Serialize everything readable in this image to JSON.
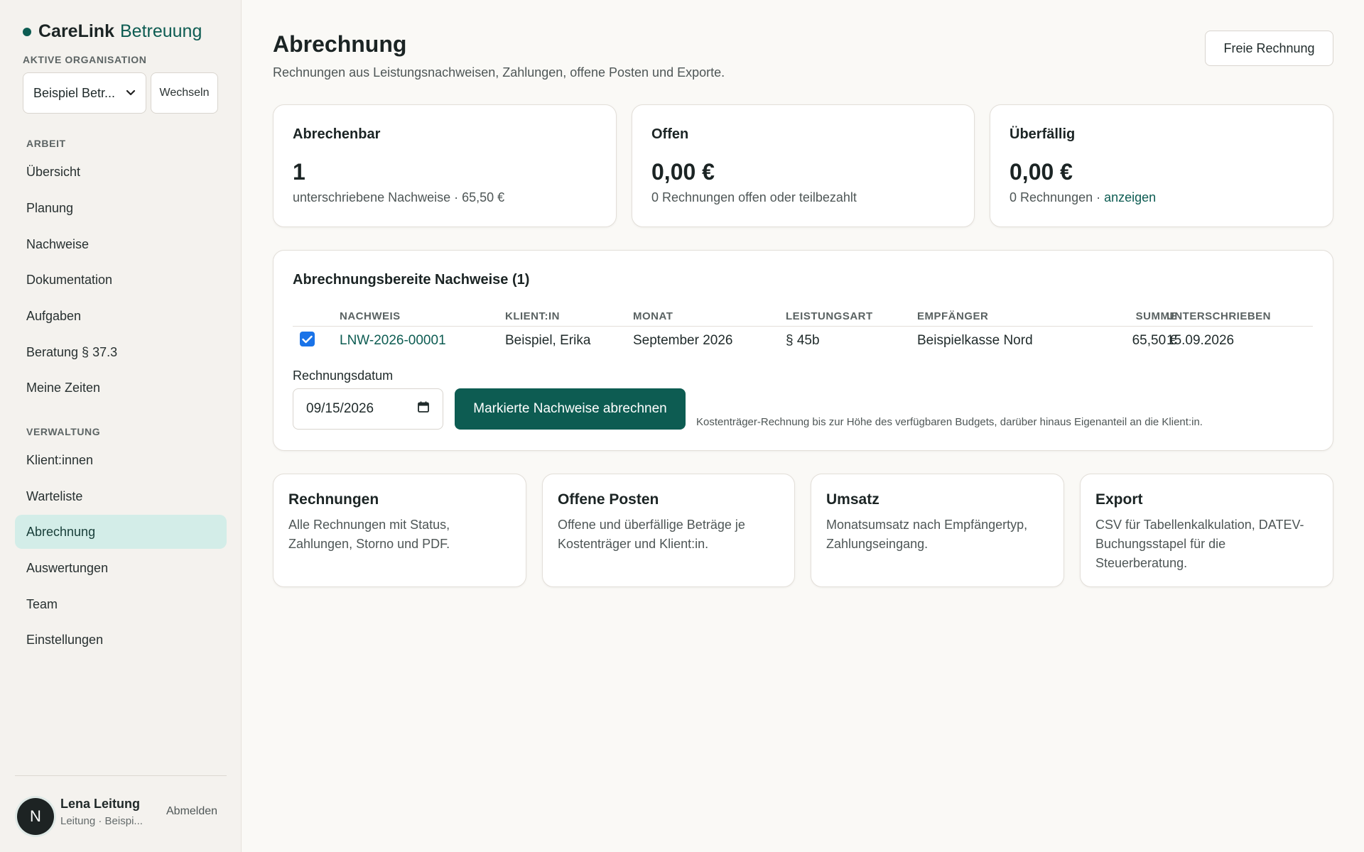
{
  "brand": {
    "name": "CareLink",
    "product": "Betreuung"
  },
  "organisation": {
    "label": "AKTIVE ORGANISATION",
    "selected": "Beispiel Betr...",
    "switch_label": "Wechseln"
  },
  "nav": {
    "work_label": "ARBEIT",
    "work_items": [
      {
        "label": "Übersicht"
      },
      {
        "label": "Planung"
      },
      {
        "label": "Nachweise"
      },
      {
        "label": "Dokumentation"
      },
      {
        "label": "Aufgaben"
      },
      {
        "label": "Beratung § 37.3"
      },
      {
        "label": "Meine Zeiten"
      }
    ],
    "admin_label": "VERWALTUNG",
    "admin_items": [
      {
        "label": "Klient:innen"
      },
      {
        "label": "Warteliste"
      },
      {
        "label": "Abrechnung"
      },
      {
        "label": "Auswertungen"
      },
      {
        "label": "Team"
      },
      {
        "label": "Einstellungen"
      }
    ]
  },
  "user": {
    "initial": "N",
    "name": "Lena Leitung",
    "role": "Leitung · Beispi...",
    "logout_label": "Abmelden"
  },
  "header": {
    "title": "Abrechnung",
    "subtitle": "Rechnungen aus Leistungsnachweisen, Zahlungen, offene Posten und Exporte.",
    "free_invoice_label": "Freie Rechnung"
  },
  "stats": {
    "billable": {
      "title": "Abrechenbar",
      "value": "1",
      "sub": "unterschriebene Nachweise · 65,50 €"
    },
    "open": {
      "title": "Offen",
      "value": "0,00 €",
      "sub": "0 Rechnungen offen oder teilbezahlt"
    },
    "overdue": {
      "title": "Überfällig",
      "value": "0,00 €",
      "sub": "0 Rechnungen ·",
      "link": "anzeigen"
    }
  },
  "ready": {
    "title": "Abrechnungsbereite Nachweise (1)",
    "columns": {
      "nachweis": "NACHWEIS",
      "klient": "KLIENT:IN",
      "monat": "MONAT",
      "leistungsart": "LEISTUNGSART",
      "empfaenger": "EMPFÄNGER",
      "summe": "SUMME",
      "unterschrieben": "UNTERSCHRIEBEN"
    },
    "rows": [
      {
        "checked": true,
        "nachweis": "LNW-2026-00001",
        "klient": "Beispiel, Erika",
        "monat": "September 2026",
        "leistungsart": "§ 45b",
        "empfaenger": "Beispielkasse Nord",
        "summe": "65,50 €",
        "unterschrieben": "15.09.2026"
      }
    ],
    "date_label": "Rechnungsdatum",
    "date_value": "09/15/2026",
    "submit_label": "Markierte Nachweise abrechnen",
    "hint": "Kostenträger-Rechnung bis zur Höhe des verfügbaren Budgets, darüber hinaus Eigenanteil an die Klient:in."
  },
  "links": [
    {
      "title": "Rechnungen",
      "desc": "Alle Rechnungen mit Status, Zahlungen, Storno und PDF."
    },
    {
      "title": "Offene Posten",
      "desc": "Offene und überfällige Beträge je Kostenträger und Klient:in."
    },
    {
      "title": "Umsatz",
      "desc": "Monatsumsatz nach Empfängertyp, Zahlungseingang."
    },
    {
      "title": "Export",
      "desc": "CSV für Tabellenkalkulation, DATEV-Buchungsstapel für die Steuerberatung."
    }
  ],
  "colors": {
    "accent": "#0d5c52",
    "active_nav_bg": "#d3ede8",
    "background": "#faf9f6",
    "sidebar_bg": "#f4f2ee"
  },
  "icons": {
    "brand": "status-dot-icon",
    "select": "chevron-down-icon",
    "date": "calendar-icon",
    "checkbox": "check-icon"
  }
}
